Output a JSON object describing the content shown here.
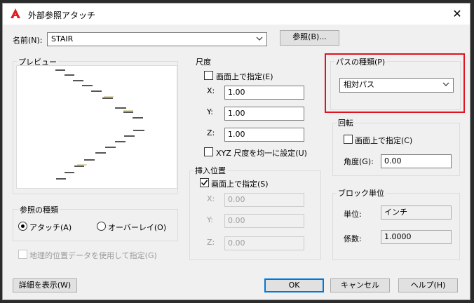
{
  "window": {
    "title": "外部参照アタッチ",
    "close_glyph": "✕"
  },
  "name_row": {
    "label": "名前(N):",
    "value": "STAIR",
    "browse": "参照(B)..."
  },
  "preview": {
    "title": "プレビュー"
  },
  "ref_type": {
    "title": "参照の種類",
    "attach": "アタッチ(A)",
    "overlay": "オーバーレイ(O)",
    "selected": "attach"
  },
  "geo": {
    "label": "地理的位置データを使用して指定(G)"
  },
  "scale": {
    "title": "尺度",
    "specify_onscreen": "画面上で指定(E)",
    "x_label": "X:",
    "x_value": "1.00",
    "y_label": "Y:",
    "y_value": "1.00",
    "z_label": "Z:",
    "z_value": "1.00",
    "uniform": "XYZ 尺度を均一に設定(U)"
  },
  "insert": {
    "title": "挿入位置",
    "specify_onscreen": "画面上で指定(S)",
    "checked": true,
    "x_label": "X:",
    "x_value": "0.00",
    "y_label": "Y:",
    "y_value": "0.00",
    "z_label": "Z:",
    "z_value": "0.00"
  },
  "path_type": {
    "title": "パスの種類(P)",
    "value": "相対パス"
  },
  "rotation": {
    "title": "回転",
    "specify_onscreen": "画面上で指定(C)",
    "angle_label": "角度(G):",
    "angle_value": "0.00"
  },
  "block_unit": {
    "title": "ブロック単位",
    "unit_label": "単位:",
    "unit_value": "インチ",
    "factor_label": "係数:",
    "factor_value": "1.0000"
  },
  "buttons": {
    "details": "詳細を表示(W)",
    "ok": "OK",
    "cancel": "キャンセル",
    "help": "ヘルプ(H)"
  },
  "colors": {
    "accent": "#0078d7",
    "highlight": "#e0141e"
  }
}
